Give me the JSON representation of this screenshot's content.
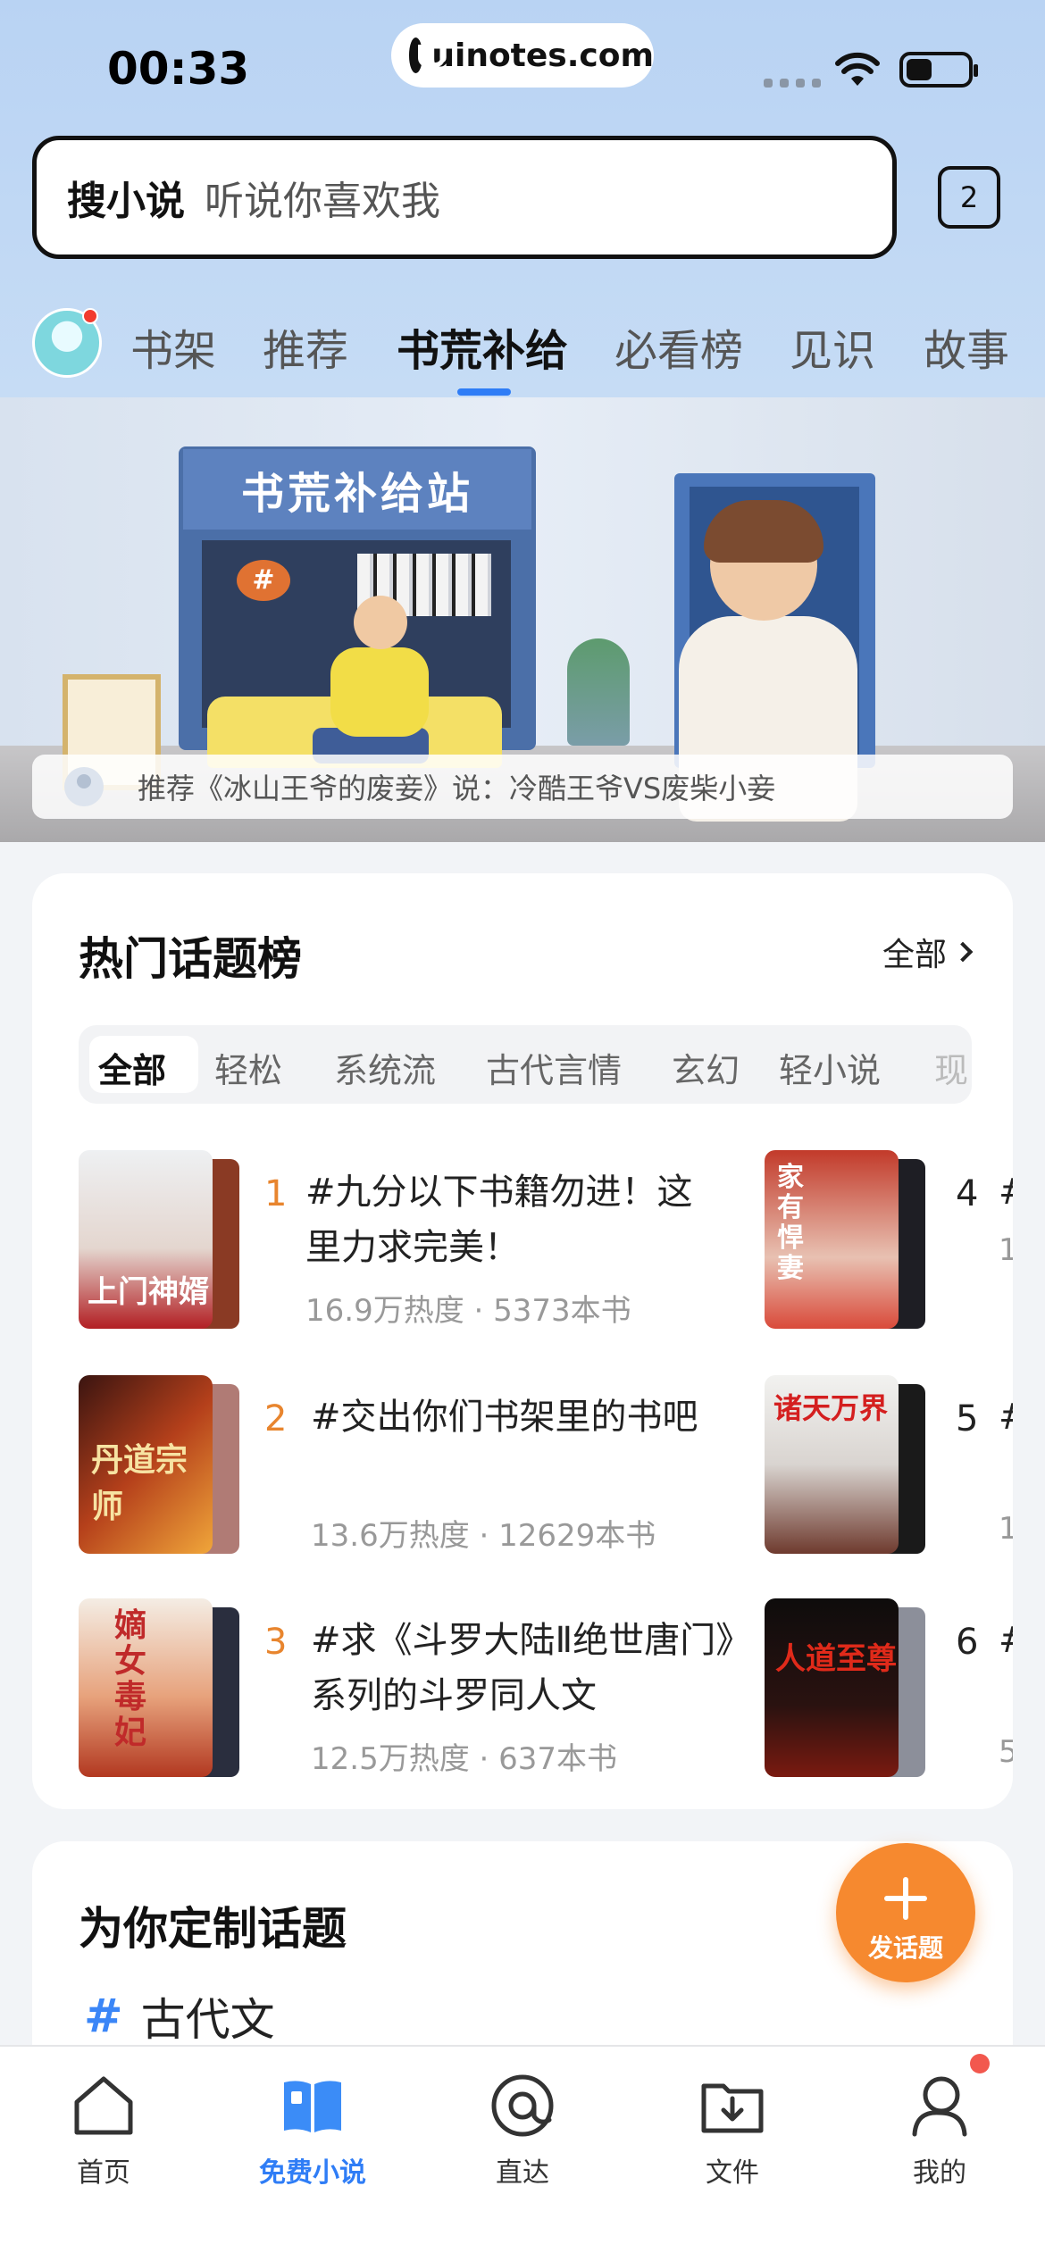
{
  "status_bar": {
    "time": "00:33",
    "url": "uinotes.com"
  },
  "search": {
    "label": "搜小说",
    "hint": "听说你喜欢我",
    "tab_count": "2"
  },
  "nav_tabs": [
    "书架",
    "推荐",
    "书荒补给",
    "必看榜",
    "见识",
    "故事"
  ],
  "active_nav_tab": "书荒补给",
  "banner": {
    "sign_text": "书荒补给站",
    "hash_badge": "#",
    "caption": "推荐《冰山王爷的废妾》说：冷酷王爷VS废柴小妾"
  },
  "hot_topics": {
    "title": "热门话题榜",
    "more_label": "全部",
    "categories": [
      "全部",
      "轻松",
      "系统流",
      "古代言情",
      "玄幻",
      "轻小说",
      "现"
    ],
    "items": [
      {
        "rank": "1",
        "title": "#九分以下书籍勿进！这里力求完美！",
        "meta": "16.9万热度 · 5373本书",
        "cover_text": "上门神婿"
      },
      {
        "rank": "2",
        "title": "#交出你们书架里的书吧",
        "meta": "13.6万热度 · 12629本书",
        "cover_text": "丹道宗师"
      },
      {
        "rank": "3",
        "title": "#求《斗罗大陆Ⅱ绝世唐门》系列的斗罗同人文",
        "meta": "12.5万热度 · 637本书",
        "cover_text": "嫡女毒妃"
      },
      {
        "rank": "4",
        "title": "#",
        "meta": "1",
        "cover_text": "家有悍妻"
      },
      {
        "rank": "5",
        "title": "#",
        "meta": "1",
        "cover_text": "诸天万界"
      },
      {
        "rank": "6",
        "title": "#",
        "meta": "5",
        "cover_text": "人道至尊"
      }
    ]
  },
  "custom_topics": {
    "title": "为你定制话题",
    "first_item_hash": "#",
    "first_item": "古代文"
  },
  "fab": {
    "label": "发话题"
  },
  "bottom_nav": [
    {
      "label": "首页",
      "icon": "home-icon"
    },
    {
      "label": "免费小说",
      "icon": "book-icon"
    },
    {
      "label": "直达",
      "icon": "at-icon"
    },
    {
      "label": "文件",
      "icon": "folder-download-icon"
    },
    {
      "label": "我的",
      "icon": "profile-icon"
    }
  ],
  "colors": {
    "accent_blue": "#2f7df6",
    "rank_orange": "#e8852e",
    "fab_orange": "#f6892f"
  }
}
